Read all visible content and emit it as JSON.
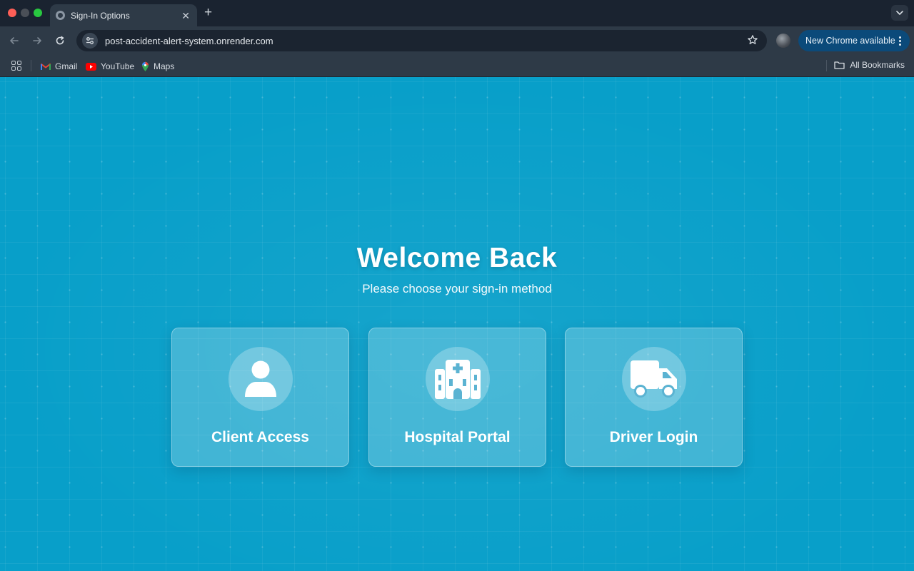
{
  "browser": {
    "tab_title": "Sign-In Options",
    "url": "post-accident-alert-system.onrender.com",
    "update_label": "New Chrome available",
    "bookmarks": [
      {
        "label": "Gmail",
        "icon": "gmail-icon"
      },
      {
        "label": "YouTube",
        "icon": "youtube-icon"
      },
      {
        "label": "Maps",
        "icon": "maps-icon"
      }
    ],
    "all_bookmarks": "All Bookmarks"
  },
  "page": {
    "heading": "Welcome Back",
    "subtitle": "Please choose your sign-in method",
    "options": [
      {
        "label": "Client Access",
        "icon": "user-icon"
      },
      {
        "label": "Hospital Portal",
        "icon": "hospital-icon"
      },
      {
        "label": "Driver Login",
        "icon": "truck-icon"
      }
    ]
  },
  "colors": {
    "page_background": "#089fc9",
    "update_pill": "#0b4a7a"
  }
}
